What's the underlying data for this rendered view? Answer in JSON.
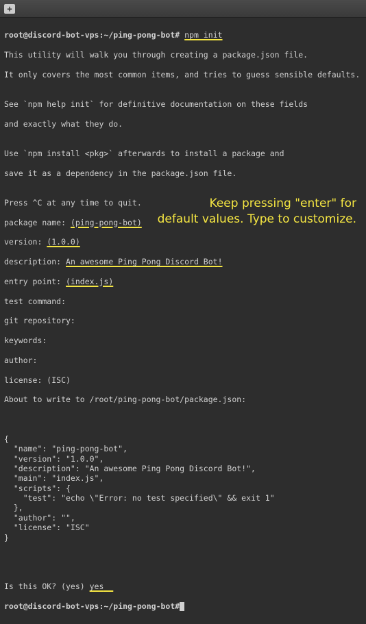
{
  "titlebar": {
    "new_tab_icon": "new-tab"
  },
  "prompt": {
    "user_host": "root@discord-bot-vps",
    "path": "~/ping-pong-bot",
    "symbol": "#"
  },
  "command": "npm init",
  "output": {
    "intro1": "This utility will walk you through creating a package.json file.",
    "intro2": "It only covers the most common items, and tries to guess sensible defaults.",
    "blank1": "",
    "help1": "See `npm help init` for definitive documentation on these fields",
    "help2": "and exactly what they do.",
    "blank2": "",
    "install1": "Use `npm install <pkg>` afterwards to install a package and",
    "install2": "save it as a dependency in the package.json file.",
    "blank3": "",
    "quit": "Press ^C at any time to quit.",
    "pkg_name_label": "package name: ",
    "pkg_name_value": "(ping-pong-bot)",
    "version_label": "version: ",
    "version_value": "(1.0.0)",
    "desc_label": "description: ",
    "desc_value": "An awesome Ping Pong Discord Bot!",
    "entry_label": "entry point: ",
    "entry_value": "(index.js)",
    "test_cmd": "test command:",
    "git_repo": "git repository:",
    "keywords": "keywords:",
    "author": "author:",
    "license": "license: (ISC)",
    "about_write": "About to write to /root/ping-pong-bot/package.json:",
    "blank4": "",
    "json": "{\n  \"name\": \"ping-pong-bot\",\n  \"version\": \"1.0.0\",\n  \"description\": \"An awesome Ping Pong Discord Bot!\",\n  \"main\": \"index.js\",\n  \"scripts\": {\n    \"test\": \"echo \\\"Error: no test specified\\\" && exit 1\"\n  },\n  \"author\": \"\",\n  \"license\": \"ISC\"\n}",
    "blank5": "",
    "blank6": "",
    "ok_label": "Is this OK? (yes) ",
    "ok_value": "yes"
  },
  "annotation": {
    "line1": "Keep pressing \"enter\" for",
    "line2": "default values. Type to customize."
  }
}
